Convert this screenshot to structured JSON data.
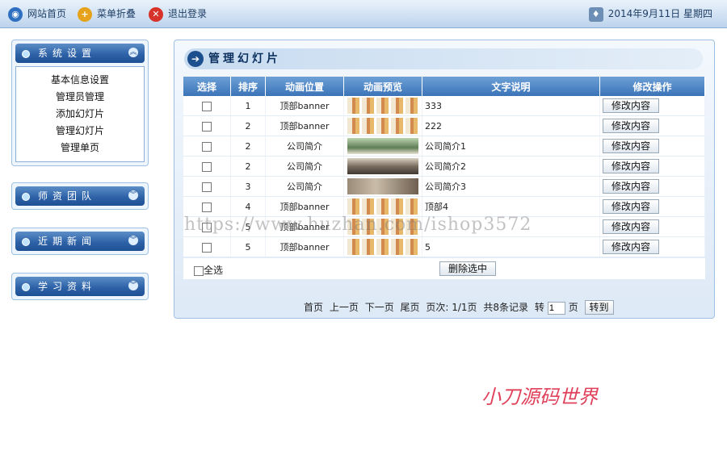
{
  "topbar": {
    "home_label": "网站首页",
    "collapse_label": "菜单折叠",
    "logout_label": "退出登录",
    "date_text": "2014年9月11日 星期四"
  },
  "sidebar": {
    "groups": [
      {
        "title": "系统设置",
        "toggle": "︽",
        "items": [
          "基本信息设置",
          "管理员管理",
          "添加幻灯片",
          "管理幻灯片",
          "管理单页"
        ]
      },
      {
        "title": "师资团队",
        "toggle": "︾"
      },
      {
        "title": "近期新闻",
        "toggle": "︾"
      },
      {
        "title": "学习资料",
        "toggle": "︾"
      }
    ]
  },
  "main": {
    "title": "管理幻灯片",
    "columns": [
      "选择",
      "排序",
      "动画位置",
      "动画预览",
      "文字说明",
      "修改操作"
    ],
    "rows": [
      {
        "order": "1",
        "position": "顶部banner",
        "preview": "people",
        "text": "333",
        "action": "修改内容"
      },
      {
        "order": "2",
        "position": "顶部banner",
        "preview": "people",
        "text": "222",
        "action": "修改内容"
      },
      {
        "order": "2",
        "position": "公司简介",
        "preview": "scene1",
        "text": "公司简介1",
        "action": "修改内容"
      },
      {
        "order": "2",
        "position": "公司简介",
        "preview": "scene2",
        "text": "公司简介2",
        "action": "修改内容"
      },
      {
        "order": "3",
        "position": "公司简介",
        "preview": "scene3",
        "text": "公司简介3",
        "action": "修改内容"
      },
      {
        "order": "4",
        "position": "顶部banner",
        "preview": "people",
        "text": "顶部4",
        "action": "修改内容"
      },
      {
        "order": "5",
        "position": "顶部banner",
        "preview": "people",
        "text": "",
        "action": "修改内容"
      },
      {
        "order": "5",
        "position": "顶部banner",
        "preview": "people",
        "text": "5",
        "action": "修改内容"
      }
    ],
    "select_all_label": "全选",
    "delete_selected_label": "删除选中"
  },
  "pager": {
    "first": "首页",
    "prev": "上一页",
    "next": "下一页",
    "last": "尾页",
    "page_info": "页次: 1/1页",
    "record_info": "共8条记录",
    "goto_prefix": "转",
    "goto_value": "1",
    "goto_suffix": "页",
    "goto_button": "转到"
  },
  "overlay": {
    "watermark": "https://www.huzhan.com/ishop3572",
    "signature": "小刀源码世界"
  }
}
